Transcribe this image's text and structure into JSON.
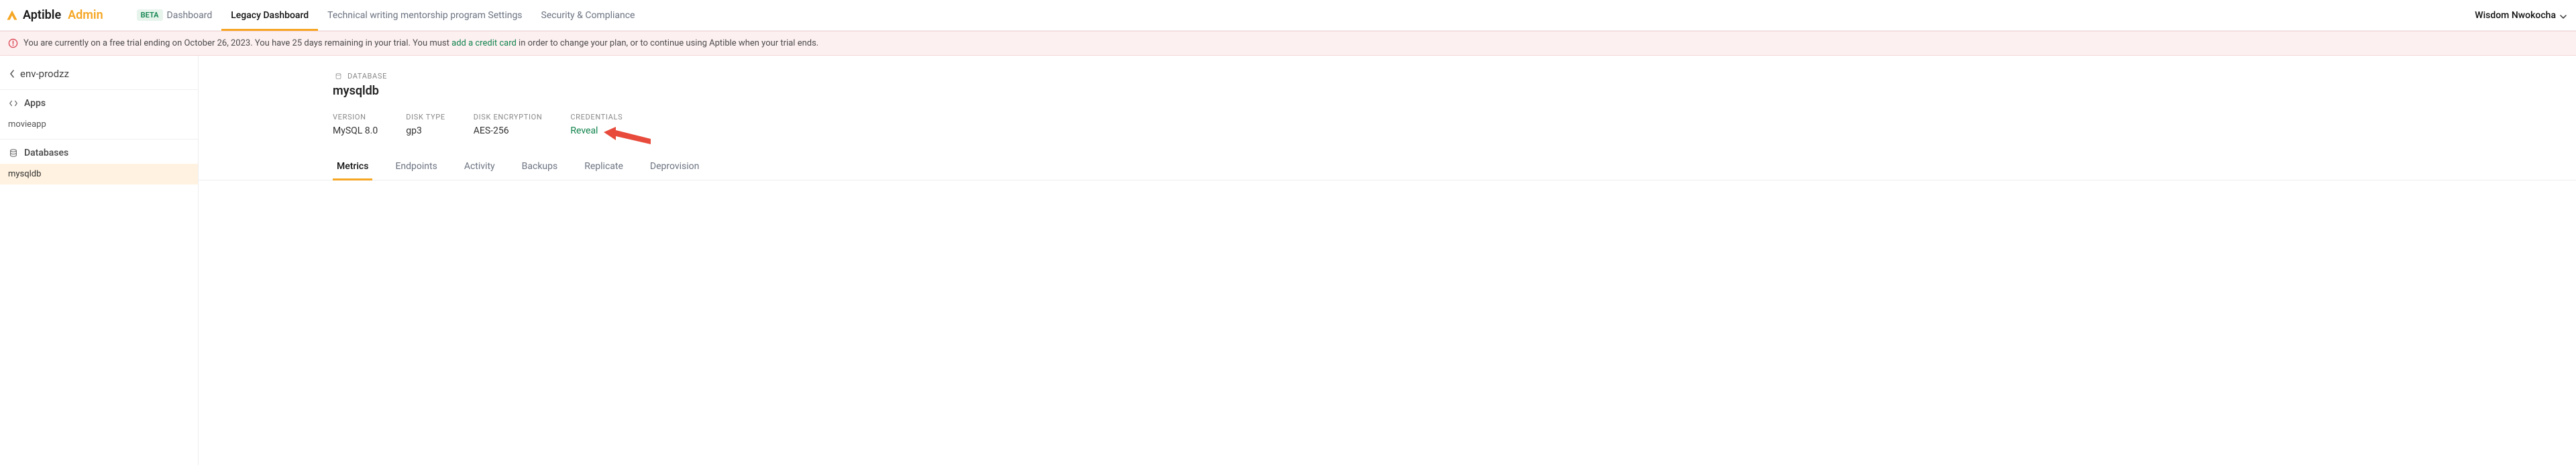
{
  "brand": {
    "name": "Aptible",
    "admin": "Admin"
  },
  "nav": {
    "beta_badge": "BETA",
    "tabs": [
      {
        "label": "Dashboard"
      },
      {
        "label": "Legacy Dashboard"
      },
      {
        "label": "Technical writing mentorship program Settings"
      },
      {
        "label": "Security & Compliance"
      }
    ],
    "user_name": "Wisdom Nwokocha"
  },
  "trial": {
    "pre": "You are currently on a free trial ending on October 26, 2023. You have 25 days remaining in your trial. You must ",
    "link": "add a credit card",
    "post": " in order to change your plan, or to continue using Aptible when your trial ends."
  },
  "sidebar": {
    "back_label": "env-prodzz",
    "sections": [
      {
        "title": "Apps",
        "items": [
          "movieapp"
        ]
      },
      {
        "title": "Databases",
        "items": [
          "mysqldb"
        ]
      }
    ]
  },
  "db": {
    "kicker": "DATABASE",
    "name": "mysqldb",
    "meta": {
      "version_label": "VERSION",
      "version": "MySQL 8.0",
      "disk_type_label": "DISK TYPE",
      "disk_type": "gp3",
      "disk_enc_label": "DISK ENCRYPTION",
      "disk_enc": "AES-256",
      "cred_label": "CREDENTIALS",
      "cred_action": "Reveal"
    },
    "subtabs": [
      "Metrics",
      "Endpoints",
      "Activity",
      "Backups",
      "Replicate",
      "Deprovision"
    ],
    "active_subtab": "Metrics"
  }
}
